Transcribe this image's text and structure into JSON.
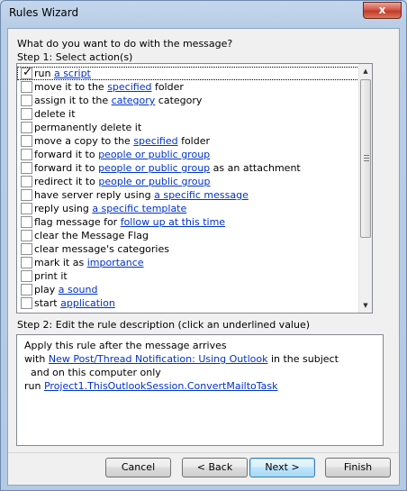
{
  "window": {
    "title": "Rules Wizard",
    "close_glyph": "x"
  },
  "prompt": "What do you want to do with the message?",
  "step1": {
    "label": "Step 1: Select action(s)",
    "actions": [
      {
        "checked": true,
        "parts": [
          {
            "t": "run "
          },
          {
            "t": "a script",
            "link": true
          }
        ]
      },
      {
        "checked": false,
        "parts": [
          {
            "t": "move it to the "
          },
          {
            "t": "specified",
            "link": true
          },
          {
            "t": " folder"
          }
        ]
      },
      {
        "checked": false,
        "parts": [
          {
            "t": "assign it to the "
          },
          {
            "t": "category",
            "link": true
          },
          {
            "t": " category"
          }
        ]
      },
      {
        "checked": false,
        "parts": [
          {
            "t": "delete it"
          }
        ]
      },
      {
        "checked": false,
        "parts": [
          {
            "t": "permanently delete it"
          }
        ]
      },
      {
        "checked": false,
        "parts": [
          {
            "t": "move a copy to the "
          },
          {
            "t": "specified",
            "link": true
          },
          {
            "t": " folder"
          }
        ]
      },
      {
        "checked": false,
        "parts": [
          {
            "t": "forward it to "
          },
          {
            "t": "people or public group",
            "link": true
          }
        ]
      },
      {
        "checked": false,
        "parts": [
          {
            "t": "forward it to "
          },
          {
            "t": "people or public group",
            "link": true
          },
          {
            "t": " as an attachment"
          }
        ]
      },
      {
        "checked": false,
        "parts": [
          {
            "t": "redirect it to "
          },
          {
            "t": "people or public group",
            "link": true
          }
        ]
      },
      {
        "checked": false,
        "parts": [
          {
            "t": "have server reply using "
          },
          {
            "t": "a specific message",
            "link": true
          }
        ]
      },
      {
        "checked": false,
        "parts": [
          {
            "t": "reply using "
          },
          {
            "t": "a specific template",
            "link": true
          }
        ]
      },
      {
        "checked": false,
        "parts": [
          {
            "t": "flag message for "
          },
          {
            "t": "follow up at this time",
            "link": true
          }
        ]
      },
      {
        "checked": false,
        "parts": [
          {
            "t": "clear the Message Flag"
          }
        ]
      },
      {
        "checked": false,
        "parts": [
          {
            "t": "clear message's categories"
          }
        ]
      },
      {
        "checked": false,
        "parts": [
          {
            "t": "mark it as "
          },
          {
            "t": "importance",
            "link": true
          }
        ]
      },
      {
        "checked": false,
        "parts": [
          {
            "t": "print it"
          }
        ]
      },
      {
        "checked": false,
        "parts": [
          {
            "t": "play "
          },
          {
            "t": "a sound",
            "link": true
          }
        ]
      },
      {
        "checked": false,
        "parts": [
          {
            "t": "start "
          },
          {
            "t": "application",
            "link": true
          }
        ]
      }
    ]
  },
  "step2": {
    "label": "Step 2: Edit the rule description (click an underlined value)",
    "lines": [
      {
        "parts": [
          {
            "t": "Apply this rule after the message arrives"
          }
        ]
      },
      {
        "parts": [
          {
            "t": "with "
          },
          {
            "t": "New Post/Thread Notification: Using Outlook",
            "link": true
          },
          {
            "t": " in the subject"
          }
        ]
      },
      {
        "parts": [
          {
            "t": "  and on this computer only"
          }
        ]
      },
      {
        "parts": [
          {
            "t": "run "
          },
          {
            "t": "Project1.ThisOutlookSession.ConvertMailtoTask",
            "link": true
          }
        ]
      }
    ]
  },
  "buttons": {
    "cancel": "Cancel",
    "back": "< Back",
    "next": "Next >",
    "finish": "Finish"
  },
  "colors": {
    "link": "#0033cc",
    "titlebar": "#c4d6ec",
    "close": "#c13b28"
  }
}
